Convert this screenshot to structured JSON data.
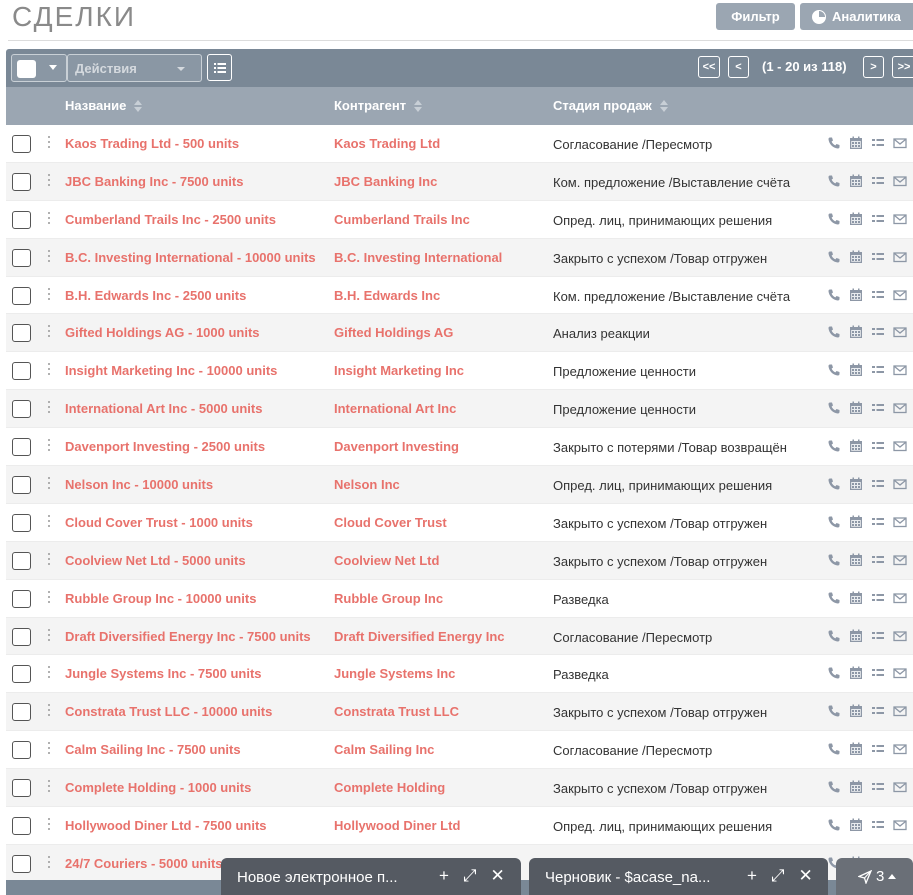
{
  "page_title": "СДЕЛКИ",
  "buttons": {
    "filter": "Фильтр",
    "analytics": "Аналитика"
  },
  "toolbar": {
    "actions_label": "Действия",
    "first": "<<",
    "prev": "<",
    "next": ">",
    "last": ">>",
    "page_info": "(1 - 20 из 118)"
  },
  "columns": {
    "name": "Название",
    "account": "Контрагент",
    "stage": "Стадия продаж"
  },
  "rows": [
    {
      "name": "Kaos Trading Ltd - 500 units",
      "account": "Kaos Trading Ltd",
      "stage": "Согласование /Пересмотр"
    },
    {
      "name": "JBC Banking Inc - 7500 units",
      "account": "JBC Banking Inc",
      "stage": "Ком. предложение /Выставление счёта"
    },
    {
      "name": "Cumberland Trails Inc - 2500 units",
      "account": "Cumberland Trails Inc",
      "stage": "Опред. лиц, принимающих решения"
    },
    {
      "name": "B.C. Investing International - 10000 units",
      "account": "B.C. Investing International",
      "stage": "Закрыто с успехом /Товар отгружен"
    },
    {
      "name": "B.H. Edwards Inc - 2500 units",
      "account": "B.H. Edwards Inc",
      "stage": "Ком. предложение /Выставление счёта"
    },
    {
      "name": "Gifted Holdings AG - 1000 units",
      "account": "Gifted Holdings AG",
      "stage": "Анализ реакции"
    },
    {
      "name": "Insight Marketing Inc - 10000 units",
      "account": "Insight Marketing Inc",
      "stage": "Предложение ценности"
    },
    {
      "name": "International Art Inc - 5000 units",
      "account": "International Art Inc",
      "stage": "Предложение ценности"
    },
    {
      "name": "Davenport Investing - 2500 units",
      "account": "Davenport Investing",
      "stage": "Закрыто с потерями /Товар возвращён"
    },
    {
      "name": "Nelson Inc - 10000 units",
      "account": "Nelson Inc",
      "stage": "Опред. лиц, принимающих решения"
    },
    {
      "name": "Cloud Cover Trust - 1000 units",
      "account": "Cloud Cover Trust",
      "stage": "Закрыто с успехом /Товар отгружен"
    },
    {
      "name": "Coolview Net Ltd - 5000 units",
      "account": "Coolview Net Ltd",
      "stage": "Закрыто с успехом /Товар отгружен"
    },
    {
      "name": "Rubble Group Inc - 10000 units",
      "account": "Rubble Group Inc",
      "stage": "Разведка"
    },
    {
      "name": "Draft Diversified Energy Inc - 7500 units",
      "account": "Draft Diversified Energy Inc",
      "stage": "Согласование /Пересмотр"
    },
    {
      "name": "Jungle Systems Inc - 7500 units",
      "account": "Jungle Systems Inc",
      "stage": "Разведка"
    },
    {
      "name": "Constrata Trust LLC - 10000 units",
      "account": "Constrata Trust LLC",
      "stage": "Закрыто с успехом /Товар отгружен"
    },
    {
      "name": "Calm Sailing Inc - 7500 units",
      "account": "Calm Sailing Inc",
      "stage": "Согласование /Пересмотр"
    },
    {
      "name": "Complete Holding - 1000 units",
      "account": "Complete Holding",
      "stage": "Закрыто с успехом /Товар отгружен"
    },
    {
      "name": "Hollywood Diner Ltd - 7500 units",
      "account": "Hollywood Diner Ltd",
      "stage": "Опред. лиц, принимающих решения"
    },
    {
      "name": "24/7 Couriers - 5000 units",
      "account": "",
      "stage": ""
    }
  ],
  "row_icons": [
    "phone-icon",
    "calendar-icon",
    "task-list-icon",
    "envelope-icon"
  ],
  "dock": {
    "window1_title": "Новое электронное п...",
    "window2_title": "Черновик - $acase_na...",
    "add": "+",
    "expand": "⤢",
    "close": "✕",
    "overflow_count": "3"
  },
  "colors": {
    "link": "#e8726c",
    "toolbar": "#7a8896",
    "header": "#9ba6b2",
    "dock": "#555a62"
  }
}
